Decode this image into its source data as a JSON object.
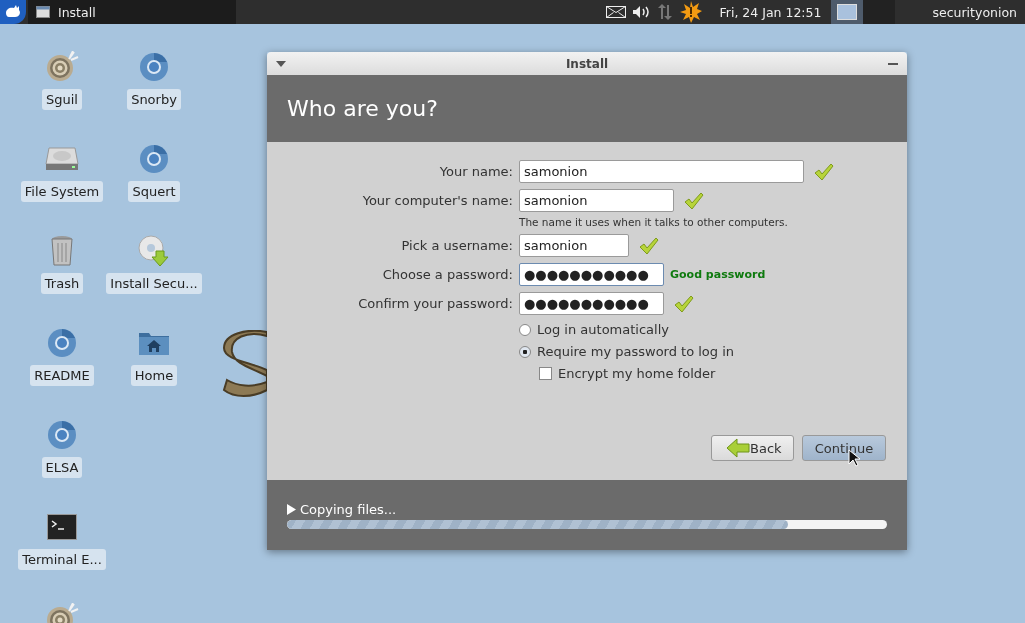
{
  "top_panel": {
    "task": {
      "title": "Install",
      "selected": true
    },
    "clock": "Fri, 24 Jan  12:51",
    "workspaces": [
      {
        "selected": true
      },
      {
        "selected": false
      }
    ],
    "user": "securityonion"
  },
  "desktop": {
    "icons": [
      {
        "kind": "onion",
        "label": "Sguil"
      },
      {
        "kind": "web",
        "label": "Snorby"
      },
      {
        "kind": "drive",
        "label": "File System"
      },
      {
        "kind": "web",
        "label": "Squert"
      },
      {
        "kind": "trash",
        "label": "Trash"
      },
      {
        "kind": "installer",
        "label": "Install Secu..."
      },
      {
        "kind": "web",
        "label": "README"
      },
      {
        "kind": "home",
        "label": "Home"
      },
      {
        "kind": "web",
        "label": "ELSA"
      },
      {
        "kind": "blank"
      },
      {
        "kind": "terminal",
        "label": "Terminal E..."
      },
      {
        "kind": "blank"
      },
      {
        "kind": "onion"
      }
    ]
  },
  "window": {
    "title": "Install",
    "heading": "Who are you?",
    "fields": [
      {
        "label": "Your name:",
        "value": "samonion",
        "valid": true
      },
      {
        "label": "Your computer's name:",
        "value": "samonion",
        "valid": true,
        "hint": "The name it uses when it talks to other computers."
      },
      {
        "label": "Pick a username:",
        "value": "samonion",
        "valid": true
      },
      {
        "label": "Choose a password:",
        "value": "●●●●●●●●●●●",
        "status": "Good password",
        "focused": true
      },
      {
        "label": "Confirm your password:",
        "value": "●●●●●●●●●●●",
        "valid": true
      }
    ],
    "login_options": [
      {
        "label": "Log in automatically",
        "selected": false
      },
      {
        "label": "Require my password to log in",
        "selected": true
      }
    ],
    "encrypt": {
      "label": "Encrypt my home folder",
      "checked": false
    },
    "buttons": [
      {
        "kind": "back",
        "label": "Back"
      },
      {
        "kind": "continue",
        "label": "Continue"
      }
    ],
    "progress": {
      "label": "Copying files...",
      "level": 0.835
    }
  }
}
